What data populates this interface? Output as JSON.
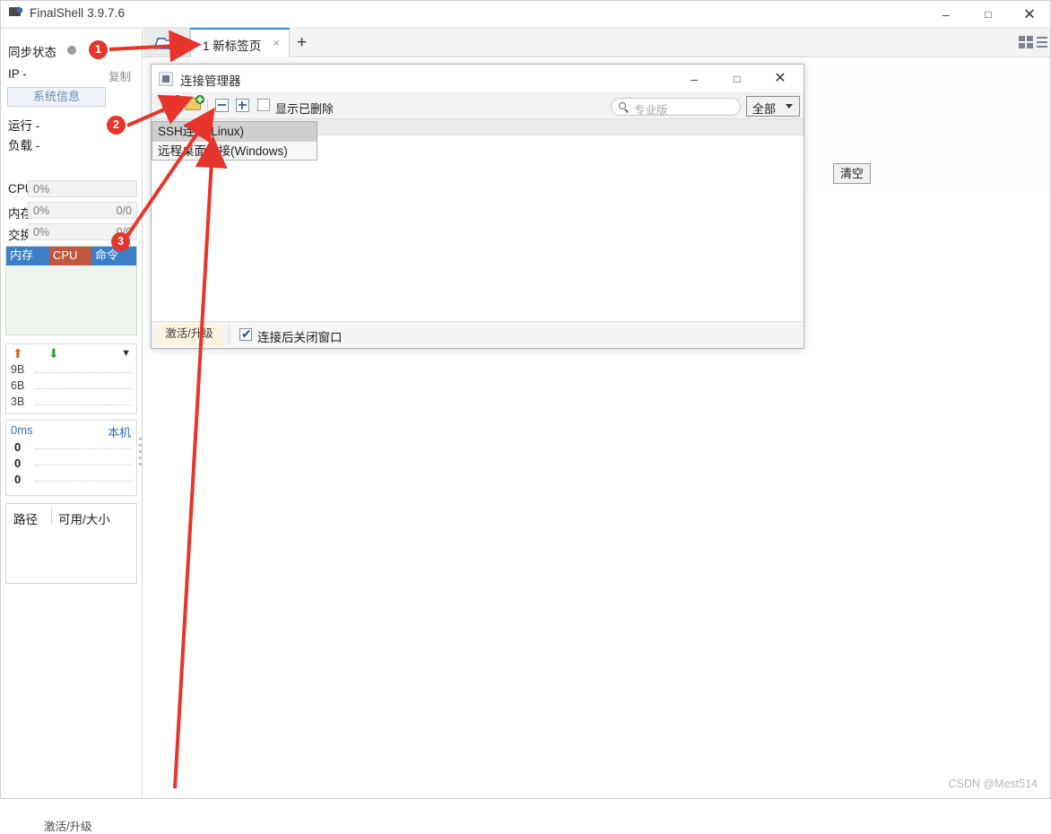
{
  "window": {
    "title": "FinalShell 3.9.7.6",
    "icon": "monitor-icon",
    "controls": {
      "minimize": "–",
      "maximize": "□",
      "close": "✕"
    }
  },
  "tabstrip": {
    "open_folder_icon": "open-folder-icon",
    "tab": {
      "label": "1 新标签页",
      "close": "×"
    },
    "add_tab": "+",
    "grid_icon": "grid-view-icon",
    "menu_icon": "hamburger-menu-icon"
  },
  "sidebar": {
    "sync_status_label": "同步状态",
    "ip_label": "IP  -",
    "copy_label": "复制",
    "system_info_button": "系统信息",
    "uptime_label": "运行 -",
    "load_label": "负载 -",
    "meters": [
      {
        "name": "CPU",
        "percent": "0%",
        "fraction": ""
      },
      {
        "name": "内存",
        "percent": "0%",
        "fraction": "0/0"
      },
      {
        "name": "交换",
        "percent": "0%",
        "fraction": "0/0"
      }
    ],
    "process_table": {
      "columns": [
        "内存",
        "CPU",
        "命令"
      ],
      "rows": []
    },
    "net_graph": {
      "upload_icon": "⬆",
      "download_icon": "⬇",
      "chevron_icon": "▼",
      "y_ticks": [
        "9B",
        "6B",
        "3B"
      ]
    },
    "latency_graph": {
      "value": "0ms",
      "host": "本机",
      "y_ticks": [
        "0",
        "0",
        "0"
      ]
    },
    "disk_table": {
      "columns": [
        "路径",
        "可用/大小"
      ],
      "rows": []
    },
    "activate_label": "激活/升级"
  },
  "background": {
    "clear_button": "清空"
  },
  "dialog": {
    "title": "连接管理器",
    "icon": "java-app-icon",
    "controls": {
      "minimize": "–",
      "maximize": "□",
      "close": "✕"
    },
    "toolbar": {
      "new_connection_icon": "new-connection-icon",
      "new_folder_icon": "new-folder-icon",
      "collapse_all_icon": "collapse-all-icon",
      "expand_all_icon": "expand-all-icon",
      "show_deleted_label": "显示已删除",
      "show_deleted_checked": false
    },
    "search": {
      "placeholder": "专业版",
      "value": "",
      "icon": "search-icon"
    },
    "filter": {
      "selected": "全部",
      "options": [
        "全部"
      ]
    },
    "list": {
      "rows": []
    },
    "footer": {
      "activate_button": "激活/升级",
      "close_after_connect_label": "连接后关闭窗口",
      "close_after_connect_checked": true,
      "check_glyph": "✔"
    }
  },
  "context_menu": {
    "items": [
      {
        "label": "SSH连接(Linux)",
        "selected": true
      },
      {
        "label": "远程桌面连接(Windows)",
        "selected": false
      }
    ]
  },
  "annotations": {
    "badges": [
      {
        "number": "1",
        "target": "open-folder-icon"
      },
      {
        "number": "2",
        "target": "new-connection-icon"
      },
      {
        "number": "3",
        "target": "ssh-connection-menu-item"
      }
    ],
    "arrow_color": "#e8352b"
  },
  "watermark": "CSDN @Mest514"
}
